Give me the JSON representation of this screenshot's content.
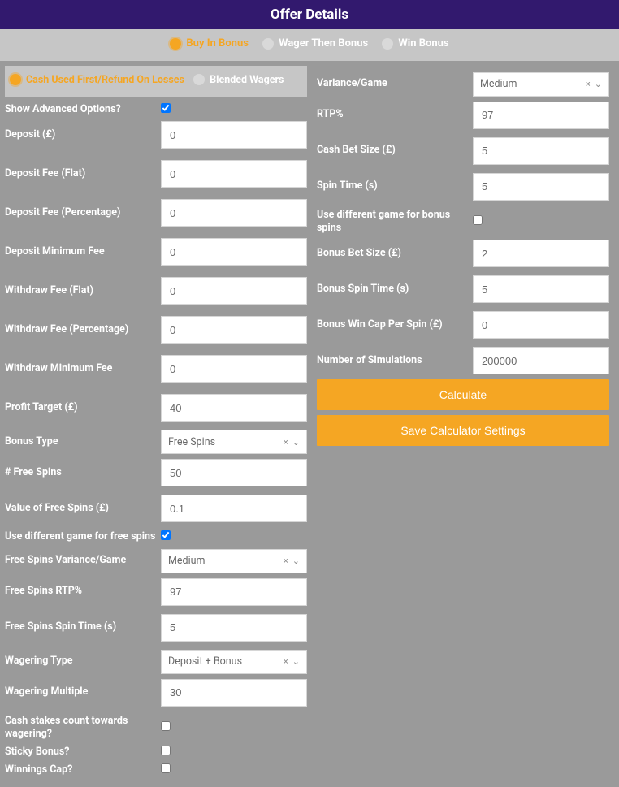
{
  "header": {
    "title": "Offer Details"
  },
  "tabs": {
    "buy_in": "Buy In Bonus",
    "wager_then": "Wager Then Bonus",
    "win": "Win Bonus"
  },
  "subtabs": {
    "cash_first": "Cash Used First/Refund On Losses",
    "blended": "Blended Wagers"
  },
  "left": {
    "show_advanced": "Show Advanced Options?",
    "deposit": {
      "label": "Deposit (£)",
      "value": "0"
    },
    "deposit_fee_flat": {
      "label": "Deposit Fee (Flat)",
      "value": "0"
    },
    "deposit_fee_pct": {
      "label": "Deposit Fee (Percentage)",
      "value": "0"
    },
    "deposit_min_fee": {
      "label": "Deposit Minimum Fee",
      "value": "0"
    },
    "withdraw_fee_flat": {
      "label": "Withdraw Fee (Flat)",
      "value": "0"
    },
    "withdraw_fee_pct": {
      "label": "Withdraw Fee (Percentage)",
      "value": "0"
    },
    "withdraw_min_fee": {
      "label": "Withdraw Minimum Fee",
      "value": "0"
    },
    "profit_target": {
      "label": "Profit Target (£)",
      "value": "40"
    },
    "bonus_type": {
      "label": "Bonus Type",
      "value": "Free Spins"
    },
    "num_free_spins": {
      "label": "# Free Spins",
      "value": "50"
    },
    "value_free_spins": {
      "label": "Value of Free Spins (£)",
      "value": "0.1"
    },
    "diff_game_free": {
      "label": "Use different game for free spins"
    },
    "fs_variance": {
      "label": "Free Spins Variance/Game",
      "value": "Medium"
    },
    "fs_rtp": {
      "label": "Free Spins RTP%",
      "value": "97"
    },
    "fs_spin_time": {
      "label": "Free Spins Spin Time (s)",
      "value": "5"
    },
    "wagering_type": {
      "label": "Wagering Type",
      "value": "Deposit + Bonus"
    },
    "wagering_multiple": {
      "label": "Wagering Multiple",
      "value": "30"
    },
    "cash_stakes": {
      "label": "Cash stakes count towards wagering?"
    },
    "sticky_bonus": {
      "label": "Sticky Bonus?"
    },
    "winnings_cap": {
      "label": "Winnings Cap?"
    }
  },
  "right": {
    "variance": {
      "label": "Variance/Game",
      "value": "Medium"
    },
    "rtp": {
      "label": "RTP%",
      "value": "97"
    },
    "cash_bet_size": {
      "label": "Cash Bet Size (£)",
      "value": "5"
    },
    "spin_time": {
      "label": "Spin Time (s)",
      "value": "5"
    },
    "diff_game_bonus": {
      "label": "Use different game for bonus spins"
    },
    "bonus_bet_size": {
      "label": "Bonus Bet Size (£)",
      "value": "2"
    },
    "bonus_spin_time": {
      "label": "Bonus Spin Time (s)",
      "value": "5"
    },
    "bonus_win_cap": {
      "label": "Bonus Win Cap Per Spin (£)",
      "value": "0"
    },
    "num_sim": {
      "label": "Number of Simulations",
      "value": "200000"
    },
    "calculate": "Calculate",
    "save": "Save Calculator Settings"
  }
}
